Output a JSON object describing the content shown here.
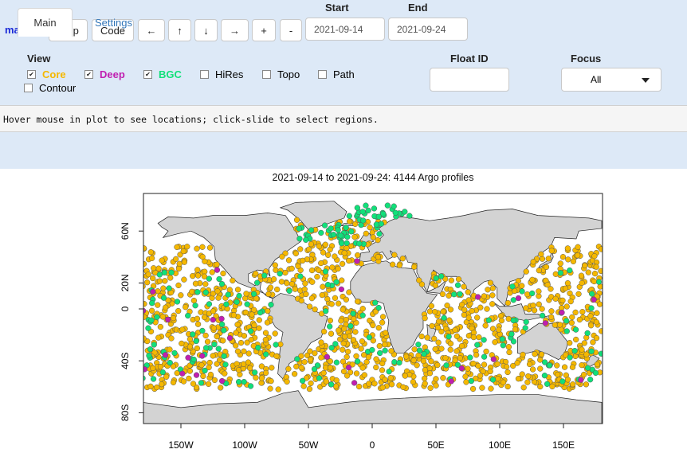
{
  "app": {
    "name": "mapApp"
  },
  "toolbar": {
    "help": "Help",
    "code": "Code",
    "left": "←",
    "up": "↑",
    "down": "↓",
    "right": "→",
    "zoom_in": "+",
    "zoom_out": "-"
  },
  "dates": {
    "start_label": "Start",
    "start_value": "2021-09-14",
    "end_label": "End",
    "end_value": "2021-09-24"
  },
  "view": {
    "label": "View",
    "items": [
      {
        "label": "Core",
        "checked": true,
        "color": "#f5b800"
      },
      {
        "label": "Deep",
        "checked": true,
        "color": "#c01fb0"
      },
      {
        "label": "BGC",
        "checked": true,
        "color": "#11e07a"
      },
      {
        "label": "HiRes",
        "checked": false
      },
      {
        "label": "Topo",
        "checked": false
      },
      {
        "label": "Path",
        "checked": false
      },
      {
        "label": "Contour",
        "checked": false
      }
    ]
  },
  "float_id": {
    "label": "Float ID",
    "value": ""
  },
  "focus": {
    "label": "Focus",
    "value": "All"
  },
  "status_message": "Hover mouse in plot to see locations; click-slide to select regions.",
  "tabs": {
    "main": "Main",
    "settings": "Settings"
  },
  "plot": {
    "title": "2021-09-14 to 2021-09-24: 4144 Argo profiles",
    "xticks": [
      "150W",
      "100W",
      "50W",
      "0",
      "50E",
      "100E",
      "150E"
    ],
    "yticks": [
      "80S",
      "40S",
      "0",
      "20N",
      "60N"
    ]
  },
  "colors": {
    "core": "#f5b800",
    "deep": "#c01fb0",
    "bgc": "#11e07a",
    "land": "#d3d3d3",
    "toolbar_bg": "#dde9f7"
  }
}
